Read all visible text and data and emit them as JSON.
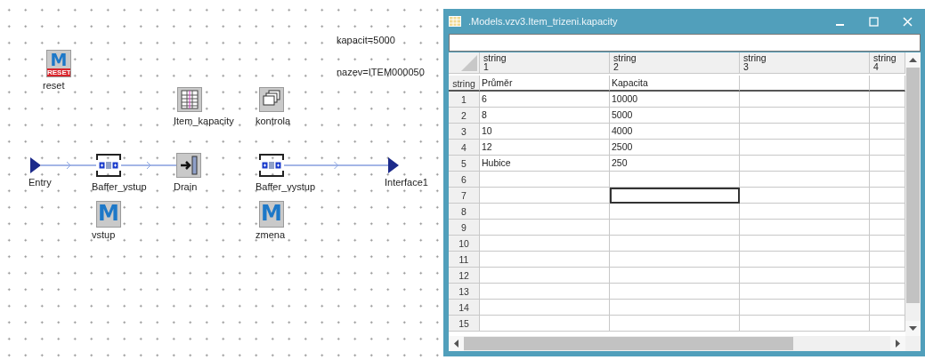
{
  "canvas": {
    "notes": [
      "kapacit=5000",
      "nazev=ITEM000050"
    ],
    "nodes": [
      {
        "kind": "method",
        "label": "reset",
        "glyph": "M",
        "badge": "RESET"
      },
      {
        "kind": "table",
        "label": "Item_kapacity"
      },
      {
        "kind": "dialog",
        "label": "kontrola"
      },
      {
        "kind": "entry",
        "label": "Entry"
      },
      {
        "kind": "buffer",
        "label": "Baffer_vstup"
      },
      {
        "kind": "drain",
        "label": "Drain"
      },
      {
        "kind": "buffer",
        "label": "Baffer_vystup"
      },
      {
        "kind": "interface",
        "label": "Interface1"
      },
      {
        "kind": "method",
        "label": "vstup",
        "glyph": "M"
      },
      {
        "kind": "method",
        "label": "zmena",
        "glyph": "M"
      }
    ]
  },
  "window": {
    "title": ".Models.vzv3.Item_trizeni.kapacity",
    "columns": [
      {
        "type": "string",
        "index": "1"
      },
      {
        "type": "string",
        "index": "2"
      },
      {
        "type": "string",
        "index": "3"
      },
      {
        "type": "string",
        "index": "4"
      }
    ],
    "header_row": {
      "type": "string",
      "cells": [
        "Průměr",
        "Kapacita"
      ]
    },
    "rows": [
      {
        "number": "1",
        "cells": [
          {
            "text": "6",
            "selected": false
          },
          {
            "text": "10000",
            "selected": false
          }
        ]
      },
      {
        "number": "2",
        "cells": [
          {
            "text": "8",
            "selected": false
          },
          {
            "text": "5000",
            "selected": false
          }
        ]
      },
      {
        "number": "3",
        "cells": [
          {
            "text": "10",
            "selected": false
          },
          {
            "text": "4000",
            "selected": false
          }
        ]
      },
      {
        "number": "4",
        "cells": [
          {
            "text": "12",
            "selected": false
          },
          {
            "text": "2500",
            "selected": false
          }
        ]
      },
      {
        "number": "5",
        "cells": [
          {
            "text": "Hubice",
            "selected": false
          },
          {
            "text": "250",
            "selected": false
          }
        ]
      },
      {
        "number": "6",
        "cells": [
          {
            "selected": false
          },
          {
            "selected": false
          }
        ]
      },
      {
        "number": "7",
        "cells": [
          {
            "selected": false
          },
          {
            "selected": true
          }
        ]
      },
      {
        "number": "8",
        "cells": [
          {
            "selected": false
          },
          {
            "selected": false
          }
        ]
      },
      {
        "number": "9",
        "cells": [
          {
            "selected": false
          },
          {
            "selected": false
          }
        ]
      },
      {
        "number": "10",
        "cells": [
          {
            "selected": false
          },
          {
            "selected": false
          }
        ]
      },
      {
        "number": "11",
        "cells": [
          {
            "selected": false
          },
          {
            "selected": false
          }
        ]
      },
      {
        "number": "12",
        "cells": [
          {
            "selected": false
          },
          {
            "selected": false
          }
        ]
      },
      {
        "number": "13",
        "cells": [
          {
            "selected": false
          },
          {
            "selected": false
          }
        ]
      },
      {
        "number": "14",
        "cells": [
          {
            "selected": false
          },
          {
            "selected": false
          }
        ]
      },
      {
        "number": "15",
        "cells": [
          {
            "selected": false
          },
          {
            "selected": false
          }
        ]
      }
    ]
  }
}
